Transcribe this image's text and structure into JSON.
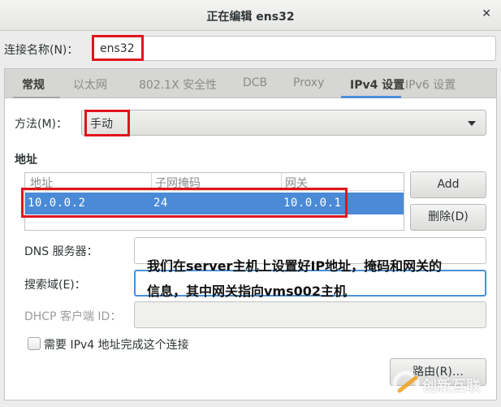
{
  "window": {
    "title": "正在编辑  ens32",
    "close_icon": "close-icon"
  },
  "connection_name": {
    "label": "连接名称(N)：",
    "value": "ens32"
  },
  "tabs": [
    {
      "label": "常规",
      "active": false
    },
    {
      "label": "以太网",
      "active": false
    },
    {
      "label": "802.1X 安全性",
      "active": false
    },
    {
      "label": "DCB",
      "active": false
    },
    {
      "label": "Proxy",
      "active": false
    },
    {
      "label": "IPv4 设置",
      "active": true
    },
    {
      "label": "IPv6 设置",
      "active": false
    }
  ],
  "method": {
    "label": "方法(M)：",
    "value": "手动"
  },
  "addresses": {
    "section_title": "地址",
    "columns": [
      "地址",
      "子网掩码",
      "网关"
    ],
    "rows": [
      {
        "address": "10.0.0.2",
        "netmask": "24",
        "gateway": "10.0.0.1",
        "selected": true
      }
    ],
    "add_label": "Add",
    "delete_label": "删除(D)"
  },
  "dns": {
    "label": "DNS 服务器：",
    "value": ""
  },
  "search_domains": {
    "label": "搜索域(E)：",
    "value": ""
  },
  "dhcp_client_id": {
    "label": "DHCP 客户端 ID：",
    "value": ""
  },
  "require_ipv4": {
    "label": "需要 IPv4 地址完成这个连接",
    "checked": false
  },
  "routes_label": "路由(R)…",
  "annotation": {
    "line1": "我们在server主机上设置好IP地址，掩码和网关的",
    "line2": "信息，其中网关指向vms002主机"
  },
  "watermark": "创新互联",
  "colors": {
    "accent": "#4a90d9",
    "selection": "#4a8ad6",
    "highlight_box": "#e0141e"
  }
}
